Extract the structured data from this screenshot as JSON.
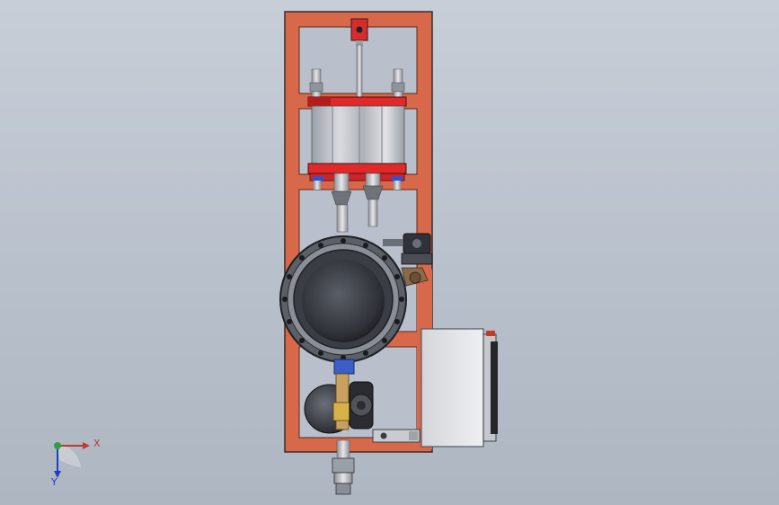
{
  "viewport": {
    "background_top": "#c7ced8",
    "background_bottom": "#aeb6c2"
  },
  "triad": {
    "x_label": "X",
    "y_label": "Y",
    "x_color": "#c0392b",
    "y_color": "#1f3fbf",
    "z_color": "#2ea043"
  },
  "colors": {
    "frame": "#d8684a",
    "frame_dark": "#8a3a24",
    "cylinder_plate": "#e02a2a",
    "metal": "#b9bcc2",
    "valve_body": "#3a3d44",
    "enclosure": "#e4e5e8"
  },
  "components": {
    "frame": "frame-assembly",
    "cylinder": "pneumatic-cylinder",
    "butterfly_valve": "butterfly-valve",
    "solenoid_valve": "solenoid-valve",
    "control_box": "electrical-enclosure",
    "actuator": "valve-actuator"
  }
}
